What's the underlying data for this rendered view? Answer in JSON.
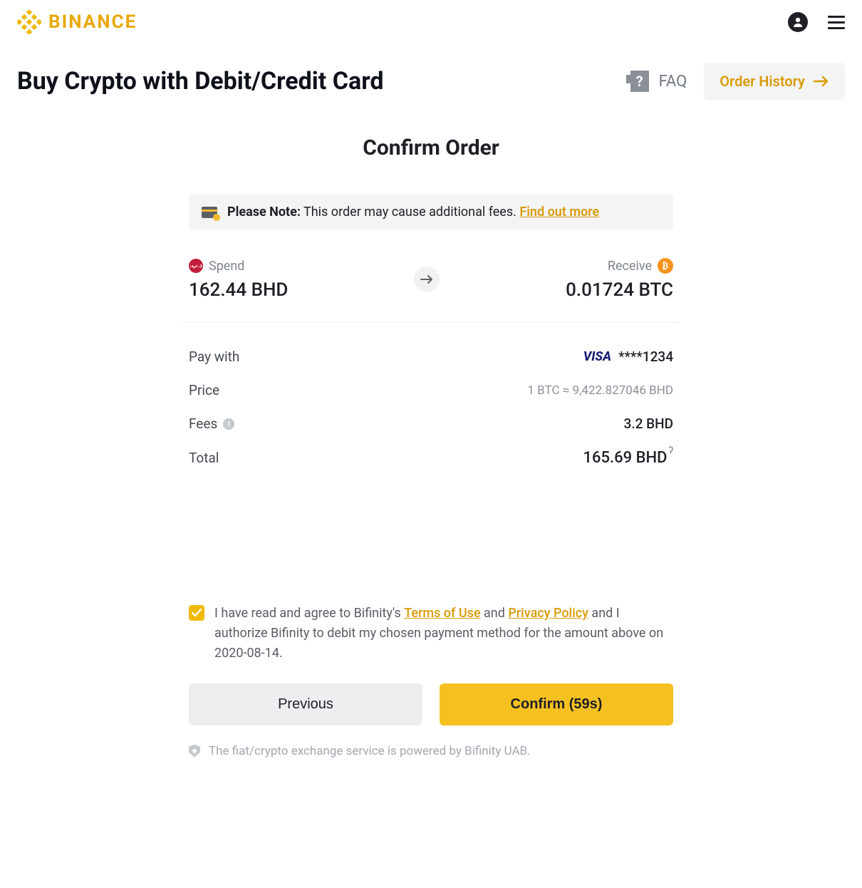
{
  "header": {
    "brand": "BINANCE"
  },
  "titlebar": {
    "page_title": "Buy Crypto with Debit/Credit Card",
    "faq_label": "FAQ",
    "order_history_label": "Order History"
  },
  "confirm": {
    "title": "Confirm Order",
    "note_strong": "Please Note:",
    "note_text": " This order may cause additional fees. ",
    "note_link": "Find out more",
    "spend_label": "Spend",
    "spend_value": "162.44 BHD",
    "receive_label": "Receive",
    "receive_value": "0.01724 BTC",
    "paywith_label": "Pay with",
    "paywith_brand": "VISA",
    "paywith_masked": "****1234",
    "price_label": "Price",
    "price_value": "1 BTC ≈ 9,422.827046 BHD",
    "fees_label": "Fees",
    "fees_value": "3.2 BHD",
    "total_label": "Total",
    "total_value": "165.69 BHD",
    "total_sup": "ʔ"
  },
  "consent": {
    "pre": "I have read and agree to Bifinity's ",
    "terms": "Terms of Use",
    "mid": " and ",
    "privacy": "Privacy Policy",
    "post": " and I authorize Bifinity to debit my chosen payment method for the amount above on 2020-08-14."
  },
  "buttons": {
    "previous": "Previous",
    "confirm": "Confirm (59s)"
  },
  "footer": {
    "text": "The fiat/crypto exchange service is powered by Bifinity UAB."
  }
}
